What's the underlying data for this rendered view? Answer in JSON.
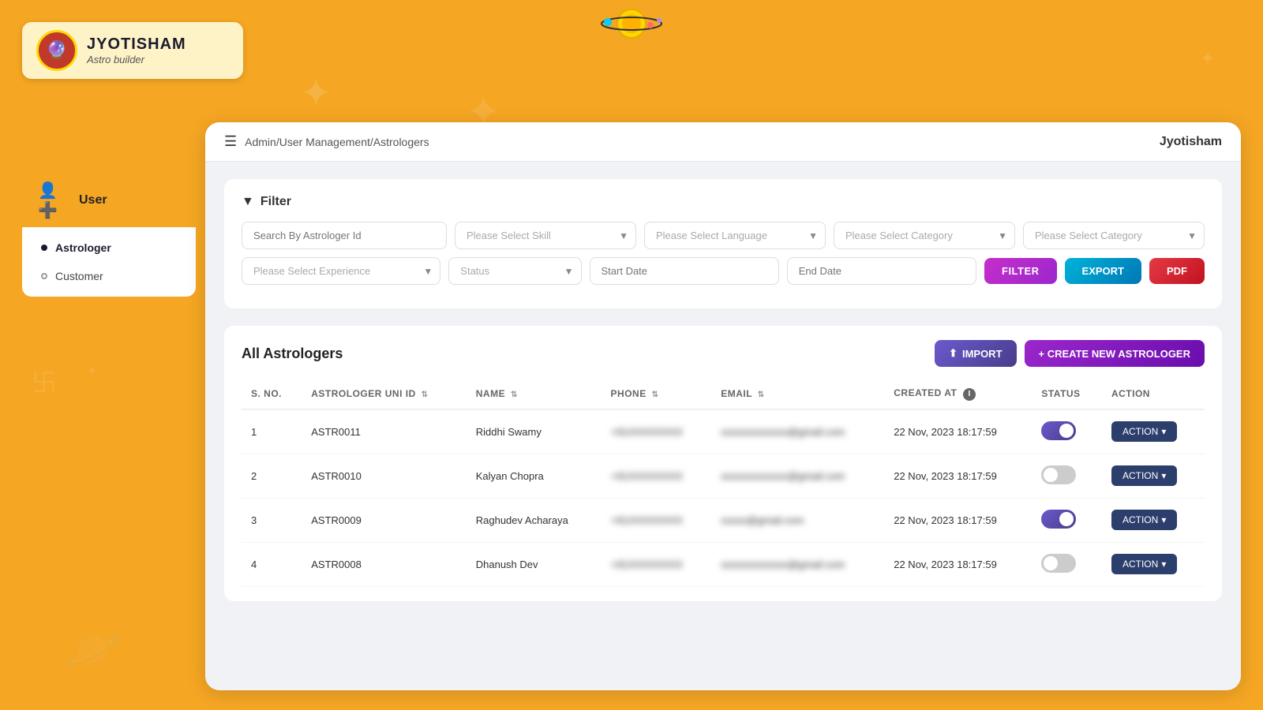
{
  "app": {
    "brand": "JYOTISHAM",
    "sub": "Astro builder",
    "user": "Jyotisham"
  },
  "header": {
    "menu_icon": "☰",
    "breadcrumb": "Admin/User Management/Astrologers"
  },
  "sidebar": {
    "section_label": "User",
    "items": [
      {
        "label": "Astrologer",
        "active": true
      },
      {
        "label": "Customer",
        "active": false
      }
    ]
  },
  "filter": {
    "title": "Filter",
    "search_placeholder": "Search By Astrologer Id",
    "skill_placeholder": "Please Select Skill",
    "language_placeholder": "Please Select Language",
    "category1_placeholder": "Please Select Category",
    "category2_placeholder": "Please Select Category",
    "experience_placeholder": "Please Select Experience",
    "status_placeholder": "Status",
    "start_date_placeholder": "Start Date",
    "end_date_placeholder": "End Date",
    "filter_btn": "FILTER",
    "export_btn": "EXPORT",
    "pdf_btn": "PDF"
  },
  "table": {
    "title": "All Astrologers",
    "import_btn": "IMPORT",
    "create_btn": "+ CREATE NEW ASTROLOGER",
    "columns": [
      "S. NO.",
      "ASTROLOGER UNI ID",
      "NAME",
      "PHONE",
      "EMAIL",
      "CREATED AT",
      "STATUS",
      "ACTION"
    ],
    "rows": [
      {
        "sno": "1",
        "uni_id": "ASTR0011",
        "name": "Riddhi Swamy",
        "phone": "+91XXXXXXXX",
        "email": "xxxxxxxxxxxxx@gmail.com",
        "created_at": "22 Nov, 2023 18:17:59",
        "status_on": true
      },
      {
        "sno": "2",
        "uni_id": "ASTR0010",
        "name": "Kalyan Chopra",
        "phone": "+91XXXXXXXX",
        "email": "xxxxxxxxxxxxx@gmail.com",
        "created_at": "22 Nov, 2023 18:17:59",
        "status_on": false
      },
      {
        "sno": "3",
        "uni_id": "ASTR0009",
        "name": "Raghudev Acharaya",
        "phone": "+91XXXXXXXX",
        "email": "xxxxx@gmail.com",
        "created_at": "22 Nov, 2023 18:17:59",
        "status_on": true
      },
      {
        "sno": "4",
        "uni_id": "ASTR0008",
        "name": "Dhanush Dev",
        "phone": "+91XXXXXXXX",
        "email": "xxxxxxxxxxxxx@gmail.com",
        "created_at": "22 Nov, 2023 18:17:59",
        "status_on": false
      }
    ],
    "action_label": "ACTION"
  },
  "colors": {
    "orange": "#f5a623",
    "purple": "#9b27cc",
    "blue": "#0077b6",
    "red": "#e63946",
    "dark_purple": "#6a5acd",
    "navy": "#2c3e6b"
  }
}
